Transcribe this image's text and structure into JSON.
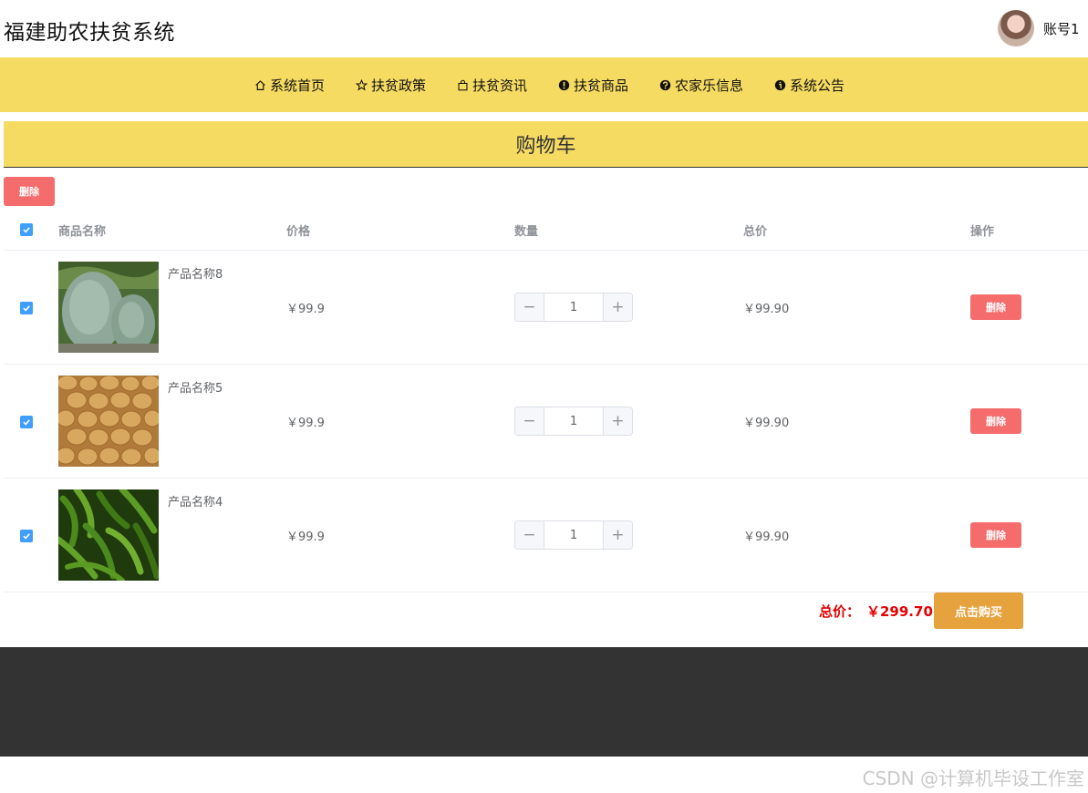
{
  "header": {
    "site_title": "福建助农扶贫系统",
    "user_name": "账号1"
  },
  "nav": {
    "items": [
      {
        "label": "系统首页",
        "icon": "home-icon"
      },
      {
        "label": "扶贫政策",
        "icon": "star-icon"
      },
      {
        "label": "扶贫资讯",
        "icon": "bag-icon"
      },
      {
        "label": "扶贫商品",
        "icon": "exclamation-icon"
      },
      {
        "label": "农家乐信息",
        "icon": "question-icon"
      },
      {
        "label": "系统公告",
        "icon": "info-icon"
      }
    ]
  },
  "cart": {
    "title": "购物车",
    "delete_selected_label": "删除",
    "columns": {
      "name": "商品名称",
      "price": "价格",
      "quantity": "数量",
      "subtotal": "总价",
      "action": "操作"
    },
    "rows": [
      {
        "name": "产品名称8",
        "price": "￥99.9",
        "quantity": "1",
        "subtotal": "￥99.90",
        "delete_label": "删除",
        "image": "winter-melon",
        "checked": true
      },
      {
        "name": "产品名称5",
        "price": "￥99.9",
        "quantity": "1",
        "subtotal": "￥99.90",
        "delete_label": "删除",
        "image": "potatoes",
        "checked": true
      },
      {
        "name": "产品名称4",
        "price": "￥99.9",
        "quantity": "1",
        "subtotal": "￥99.90",
        "delete_label": "删除",
        "image": "green-peppers",
        "checked": true
      }
    ],
    "total_label": "总价：",
    "total_value": "￥299.70",
    "buy_label": "点击购买"
  },
  "watermark": "CSDN @计算机毕设工作室",
  "colors": {
    "accent_yellow": "#f6db62",
    "danger": "#f56c6c",
    "warning": "#e6a23c",
    "checkbox": "#409eff",
    "total_red": "#e60000",
    "footer": "#333333"
  }
}
